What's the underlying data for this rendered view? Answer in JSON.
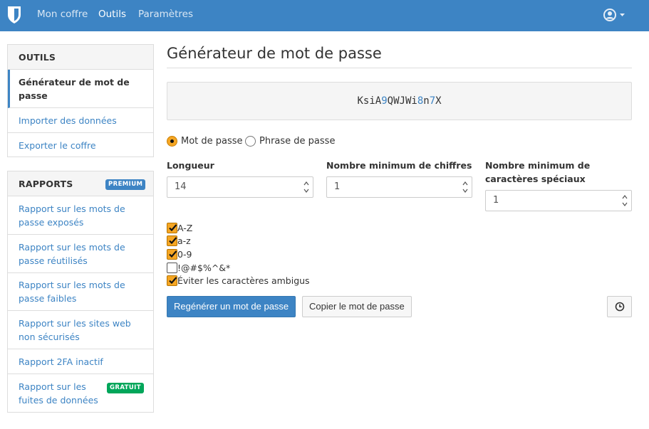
{
  "nav": {
    "brand": "bitwarden-shield-logo",
    "links": [
      "Mon coffre",
      "Outils",
      "Paramètres"
    ],
    "active": "Outils",
    "account_icon": "user-circle-icon"
  },
  "sidebar": {
    "tools": {
      "header": "OUTILS",
      "items": [
        "Générateur de mot de passe",
        "Importer des données",
        "Exporter le coffre"
      ],
      "active": "Générateur de mot de passe"
    },
    "reports": {
      "header": "RAPPORTS",
      "badge": "PREMIUM",
      "items": [
        "Rapport sur les mots de passe exposés",
        "Rapport sur les mots de passe réutilisés",
        "Rapport sur les mots de passe faibles",
        "Rapport sur les sites web non sécurisés",
        "Rapport 2FA inactif",
        "Rapport sur les fuites de données"
      ],
      "free_badge": "GRATUIT"
    }
  },
  "main": {
    "title": "Générateur de mot de passe",
    "generated_password": "KsiA9QWJWi8n7X",
    "type_options": [
      "Mot de passe",
      "Phrase de passe"
    ],
    "selected_type": "Mot de passe",
    "fields": {
      "length": {
        "label": "Longueur",
        "value": "14"
      },
      "min_numbers": {
        "label": "Nombre minimum de chiffres",
        "value": "1"
      },
      "min_special": {
        "label": "Nombre minimum de caractères spéciaux",
        "value": "1"
      }
    },
    "checkboxes": [
      {
        "label": "A-Z",
        "checked": true
      },
      {
        "label": "a-z",
        "checked": true
      },
      {
        "label": "0-9",
        "checked": true
      },
      {
        "label": "!@#$%^&*",
        "checked": false
      },
      {
        "label": "Éviter les caractères ambigus",
        "checked": true
      }
    ],
    "buttons": {
      "regenerate": "Regénérer un mot de passe",
      "copy": "Copier le mot de passe",
      "history_icon": "clock-history-icon"
    }
  },
  "colors": {
    "brand_blue": "#3d84c4",
    "checkbox_orange": "#f5a623",
    "free_badge_green": "#00a65a"
  }
}
